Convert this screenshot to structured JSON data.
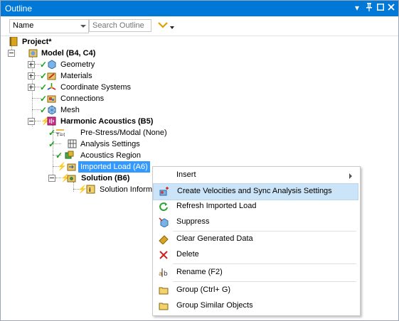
{
  "window": {
    "title": "Outline",
    "pin_glyph": "▾",
    "pushpin_glyph": "ᵾ",
    "close_glyph": "✕"
  },
  "toolbar": {
    "name_select": "Name",
    "search_placeholder": "Search Outline"
  },
  "tree": {
    "project": "Project*",
    "model": "Model (B4, C4)",
    "geometry": "Geometry",
    "materials": "Materials",
    "coordinate_systems": "Coordinate Systems",
    "connections": "Connections",
    "mesh": "Mesh",
    "harmonic_acoustics": "Harmonic Acoustics (B5)",
    "prestress": "Pre-Stress/Modal (None)",
    "analysis_settings": "Analysis Settings",
    "acoustics_region": "Acoustics Region",
    "imported_load": "Imported Load (A6)",
    "solution": "Solution (B6)",
    "solution_information": "Solution Informa"
  },
  "context_menu": {
    "insert": "Insert",
    "create_velocities": "Create Velocities and Sync Analysis Settings",
    "refresh": "Refresh Imported Load",
    "suppress": "Suppress",
    "clear_generated": "Clear Generated Data",
    "delete": "Delete",
    "rename": "Rename (F2)",
    "group": "Group (Ctrl+ G)",
    "group_similar": "Group Similar Objects"
  },
  "colors": {
    "title_bar": "#0078d7",
    "selection": "#3399ff",
    "menu_highlight": "#cce4f7",
    "check": "#14a414"
  }
}
